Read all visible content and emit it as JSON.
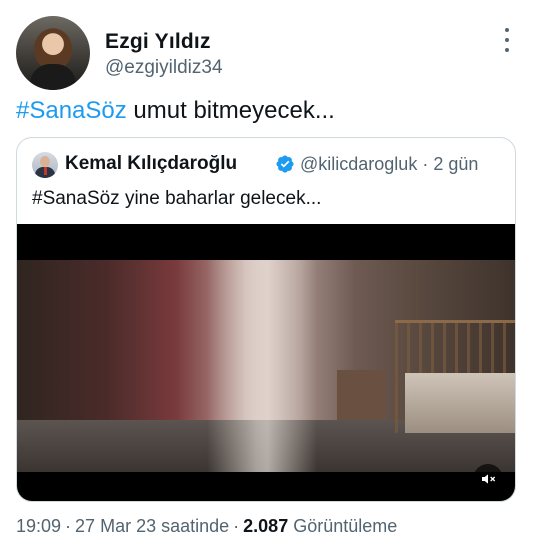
{
  "author": {
    "display_name": "Ezgi Yıldız",
    "handle": "@ezgiyildiz34"
  },
  "tweet": {
    "hashtag": "#SanaSöz",
    "text": " umut bitmeyecek..."
  },
  "quoted_tweet": {
    "display_name": "Kemal Kılıçdaroğlu",
    "handle": "@kilicdarogluk",
    "separator": "·",
    "time_ago": "2 gün",
    "text": "#SanaSöz yine baharlar gelecek..."
  },
  "meta": {
    "time": "19:09",
    "date": "27 Mar 23 saatinde",
    "separator": "·",
    "views_count": "2.087",
    "views_label": "Görüntüleme"
  },
  "colors": {
    "link": "#1d9bf0",
    "secondary_text": "#536471",
    "verified": "#1d9bf0"
  },
  "icons": {
    "more": "more-options-icon",
    "verified": "verified-badge-icon",
    "mute": "volume-muted-icon"
  }
}
